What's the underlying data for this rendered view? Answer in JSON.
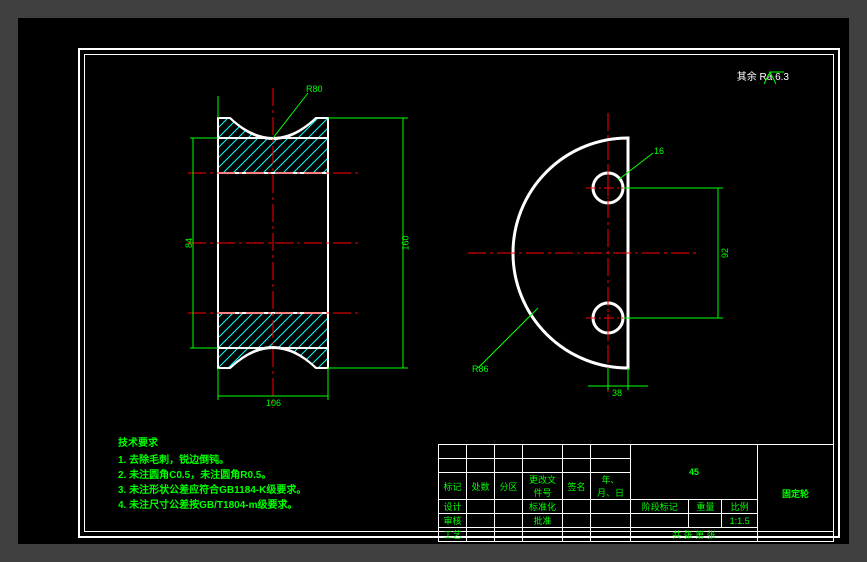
{
  "surface": {
    "prefix": "其余",
    "value": "Ra 6.3"
  },
  "dims": {
    "left_top": "R80",
    "left_v1": "84",
    "left_v2": "160",
    "left_bottom": "106",
    "right_top": "16",
    "right_side": "92",
    "right_bottom": "38",
    "right_lead": "R86"
  },
  "notes": {
    "title": "技术要求",
    "l1": "1. 去除毛刺，锐边倒钝。",
    "l2": "2. 未注圆角C0.5，未注圆角R0.5。",
    "l3": "3. 未注形状公差应符合GB1184-K级要求。",
    "l4": "4. 未注尺寸公差按GB/T1804-m级要求。"
  },
  "titleblock": {
    "h_mark": "标记",
    "h_qty": "处数",
    "h_zone": "分区",
    "h_doc": "更改文件号",
    "h_sign": "签名",
    "h_date": "年、月、日",
    "h_design": "设计",
    "h_std": "标准化",
    "h_stage": "阶段标记",
    "h_weight": "重量",
    "h_scale": "比例",
    "h_check": "审核",
    "h_appr": "批准",
    "scale": "1:1.5",
    "h_proc": "工艺",
    "h_sheet": "共  张 第  张",
    "material": "45",
    "part_name": "固定轮"
  }
}
